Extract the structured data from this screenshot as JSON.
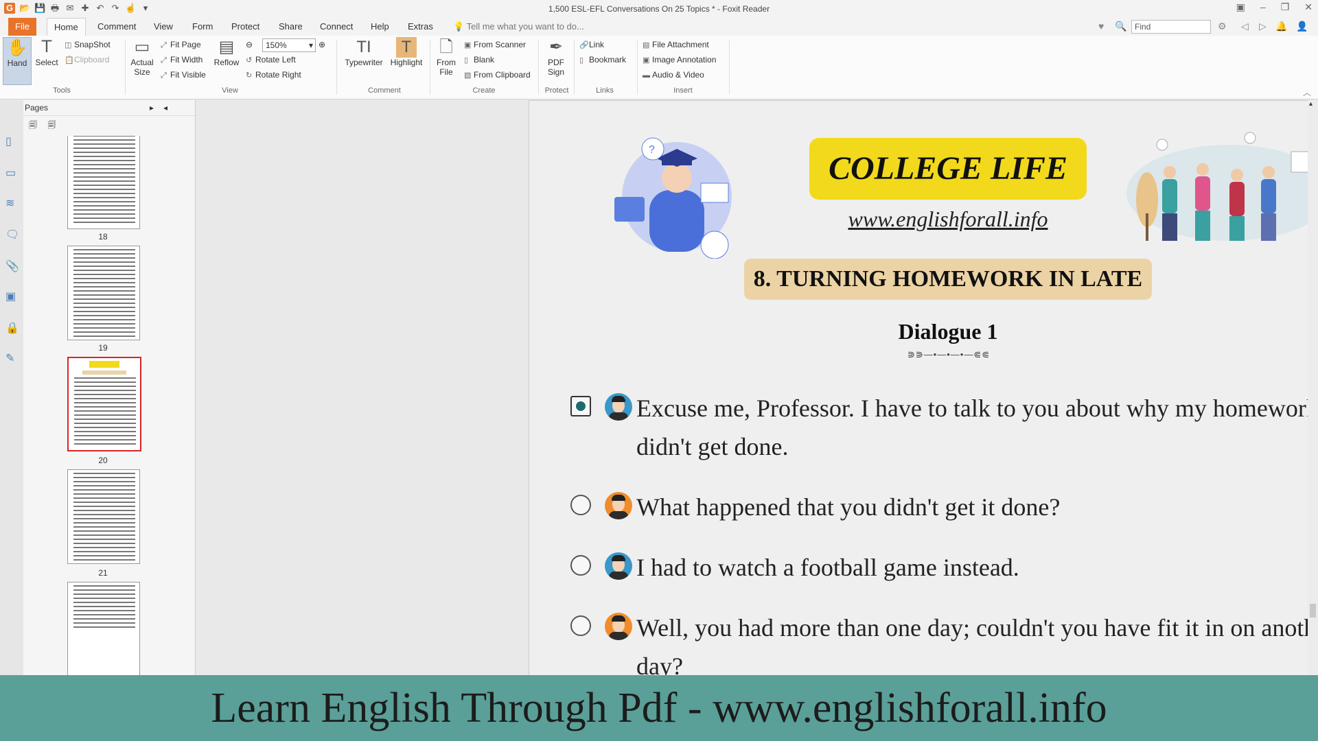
{
  "window": {
    "title": "1,500 ESL-EFL Conversations On 25 Topics * - Foxit Reader"
  },
  "menu": {
    "tabs": [
      "File",
      "Home",
      "Comment",
      "View",
      "Form",
      "Protect",
      "Share",
      "Connect",
      "Help",
      "Extras"
    ],
    "tellme": "Tell me what you want to do...",
    "find_placeholder": "Find"
  },
  "ribbon": {
    "tools": {
      "hand": "Hand",
      "select": "Select",
      "snapshot": "SnapShot",
      "clipboard": "Clipboard",
      "group": "Tools"
    },
    "view": {
      "actual_size_1": "Actual",
      "actual_size_2": "Size",
      "fit_page": "Fit Page",
      "fit_width": "Fit Width",
      "fit_visible": "Fit Visible",
      "reflow": "Reflow",
      "zoom": "150%",
      "rotate_left": "Rotate Left",
      "rotate_right": "Rotate Right",
      "group": "View"
    },
    "comment": {
      "typewriter": "Typewriter",
      "highlight": "Highlight",
      "group": "Comment"
    },
    "create": {
      "from_file_1": "From",
      "from_file_2": "File",
      "from_scanner": "From Scanner",
      "blank": "Blank",
      "from_clipboard": "From Clipboard",
      "group": "Create"
    },
    "protect": {
      "pdf_sign_1": "PDF",
      "pdf_sign_2": "Sign",
      "group": "Protect"
    },
    "links": {
      "link": "Link",
      "bookmark": "Bookmark",
      "group": "Links"
    },
    "insert": {
      "file_attachment": "File Attachment",
      "image_annotation": "Image Annotation",
      "audio_video": "Audio & Video",
      "group": "Insert"
    }
  },
  "pages_panel": {
    "title": "Pages",
    "thumbnails": [
      {
        "label": "18"
      },
      {
        "label": "19"
      },
      {
        "label": "20",
        "selected": true
      },
      {
        "label": "21"
      },
      {
        "label": ""
      }
    ]
  },
  "document": {
    "heading": "COLLEGE LIFE",
    "website": "www.englishforall.info",
    "topic": "8. TURNING HOMEWORK IN LATE",
    "dialogue_title": "Dialogue 1",
    "lines": [
      {
        "speaker": "male",
        "text": "Excuse me, Professor. I have to talk to you about why my homework didn't get done.",
        "active": true
      },
      {
        "speaker": "female",
        "text": "What happened that you didn't get it done?",
        "active": false
      },
      {
        "speaker": "male",
        "text": "I had to watch a football game instead.",
        "active": false
      },
      {
        "speaker": "female",
        "text": "Well, you had more than one day; couldn't you have fit it in on another day?",
        "active": false
      }
    ]
  },
  "banner": {
    "text": "Learn English Through Pdf - www.englishforall.info"
  },
  "colors": {
    "accent": "#e8732b",
    "title_pill": "#f2d91b",
    "topic_pill": "#ebd3a5",
    "banner": "#5a9f98"
  }
}
